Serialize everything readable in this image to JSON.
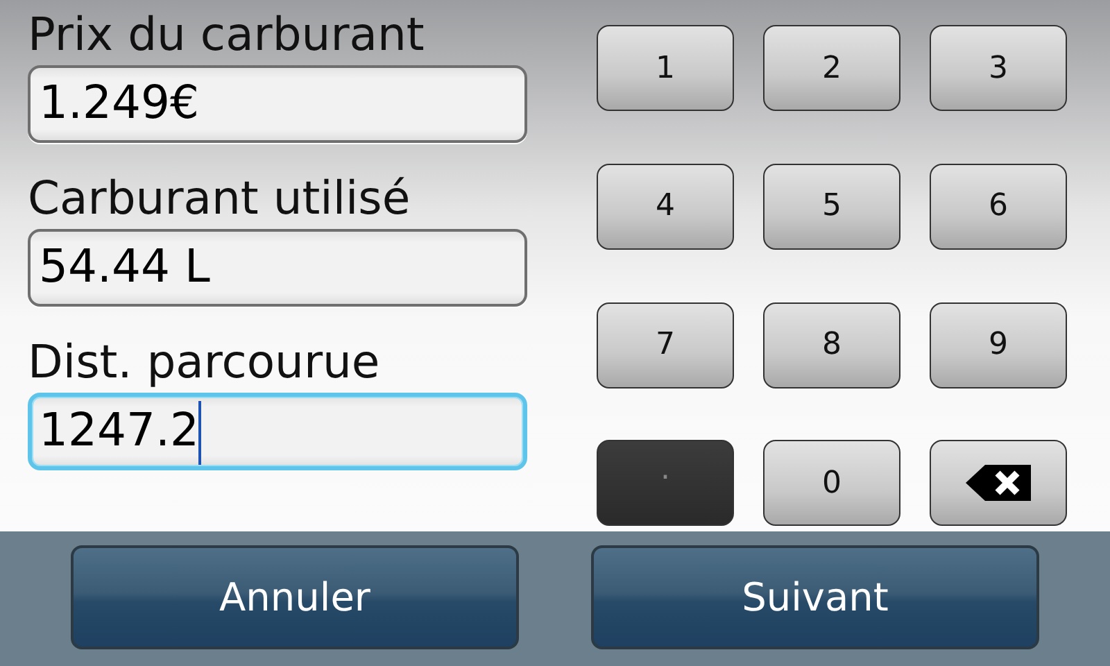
{
  "fields": [
    {
      "label": "Prix du carburant",
      "value": "1.249€",
      "focused": false
    },
    {
      "label": "Carburant utilisé",
      "value": "54.44 L",
      "focused": false
    },
    {
      "label": "Dist. parcourue",
      "value": "1247.2",
      "focused": true
    }
  ],
  "keypad": [
    {
      "kind": "digit",
      "label": "1",
      "pressed": false
    },
    {
      "kind": "digit",
      "label": "2",
      "pressed": false
    },
    {
      "kind": "digit",
      "label": "3",
      "pressed": false
    },
    {
      "kind": "digit",
      "label": "4",
      "pressed": false
    },
    {
      "kind": "digit",
      "label": "5",
      "pressed": false
    },
    {
      "kind": "digit",
      "label": "6",
      "pressed": false
    },
    {
      "kind": "digit",
      "label": "7",
      "pressed": false
    },
    {
      "kind": "digit",
      "label": "8",
      "pressed": false
    },
    {
      "kind": "digit",
      "label": "9",
      "pressed": false
    },
    {
      "kind": "digit",
      "label": ".",
      "pressed": true
    },
    {
      "kind": "digit",
      "label": "0",
      "pressed": false
    },
    {
      "kind": "backspace",
      "pressed": false
    }
  ],
  "buttons": [
    {
      "label": "Annuler"
    },
    {
      "label": "Suivant"
    }
  ]
}
